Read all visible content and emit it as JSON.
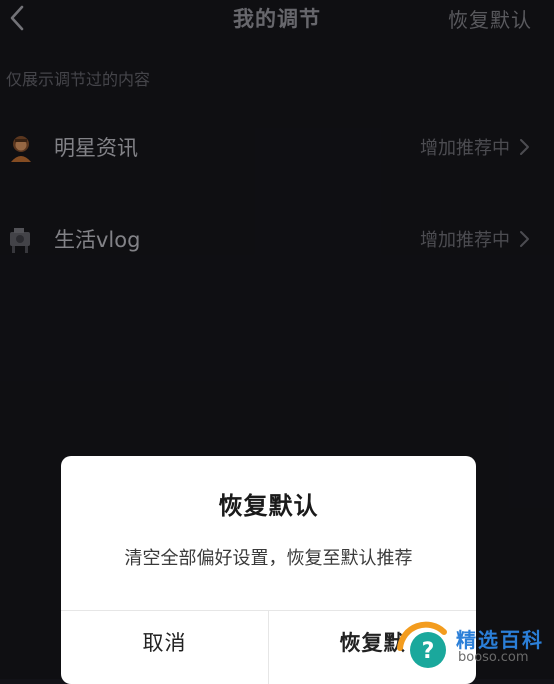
{
  "header": {
    "title": "我的调节",
    "restore_label": "恢复默认"
  },
  "hint": "仅展示调节过的内容",
  "items": [
    {
      "label": "明星资讯",
      "status": "增加推荐中",
      "icon": "celebrity-icon"
    },
    {
      "label": "生活vlog",
      "status": "增加推荐中",
      "icon": "vlog-icon"
    }
  ],
  "dialog": {
    "title": "恢复默认",
    "message": "清空全部偏好设置，恢复至默认推荐",
    "cancel_label": "取消",
    "confirm_label": "恢复默"
  },
  "watermark": {
    "main": "精选百科",
    "sub": "booso.com"
  },
  "colors": {
    "background": "#141419",
    "dialog_bg": "#ffffff",
    "watermark_orange": "#f39c1e",
    "watermark_teal": "#1aa89c"
  }
}
